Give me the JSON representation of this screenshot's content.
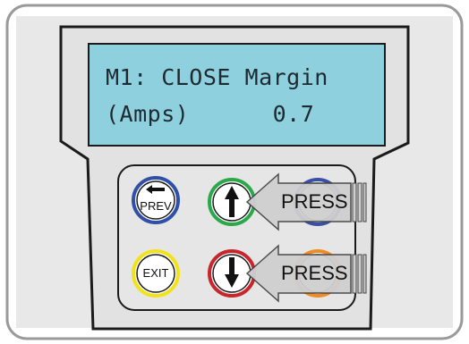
{
  "lcd": {
    "line1": "M1: CLOSE Margin",
    "line2": "(Amps)      0.7"
  },
  "buttons": {
    "prev": {
      "label": "PREV",
      "ring_color": "#2f4fa8"
    },
    "up": {
      "ring_color": "#2aa84a"
    },
    "top_right": {
      "ring_color": "#3a4fa6"
    },
    "exit": {
      "label": "EXIT",
      "ring_color": "#f2e21a"
    },
    "down": {
      "ring_color": "#c9262c"
    },
    "bottom_right": {
      "ring_color": "#f08a24"
    }
  },
  "callouts": {
    "press_top": "PRESS",
    "press_bottom": "PRESS"
  },
  "colors": {
    "panel_bg": "#e8e8e8",
    "lcd_bg": "#8fd0df",
    "arrow_fill": "#cfcfcf",
    "frame_border": "#9a9a9a"
  }
}
